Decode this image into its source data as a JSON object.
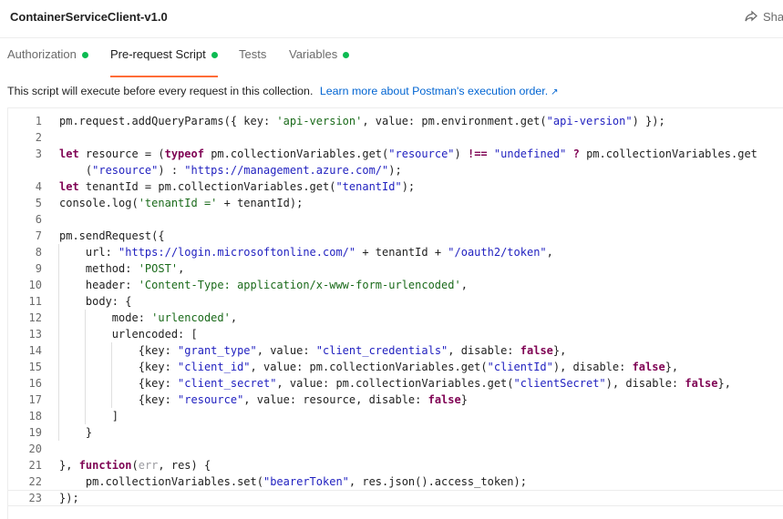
{
  "header": {
    "title": "ContainerServiceClient-v1.0",
    "share_label": "Sha"
  },
  "tabs": [
    {
      "label": "Authorization",
      "active": false,
      "dot": true
    },
    {
      "label": "Pre-request Script",
      "active": true,
      "dot": true
    },
    {
      "label": "Tests",
      "active": false,
      "dot": false
    },
    {
      "label": "Variables",
      "active": false,
      "dot": true
    }
  ],
  "description": {
    "text": "This script will execute before every request in this collection.",
    "link": "Learn more about Postman's execution order.",
    "link_icon": "↗"
  },
  "editor": {
    "lines": [
      {
        "num": "1",
        "tokens": [
          [
            "",
            "pm.request.addQueryParams({ key: "
          ],
          [
            "str2",
            "'api-version'"
          ],
          [
            "",
            ", value: pm.environment.get("
          ],
          [
            "str",
            "\"api-version\""
          ],
          [
            "",
            ") });"
          ]
        ]
      },
      {
        "num": "2",
        "tokens": []
      },
      {
        "num": "3",
        "tokens": [
          [
            "kw",
            "let"
          ],
          [
            "",
            " resource = ("
          ],
          [
            "kw",
            "typeof"
          ],
          [
            "",
            " pm.collectionVariables.get("
          ],
          [
            "str",
            "\"resource\""
          ],
          [
            "",
            ") "
          ],
          [
            "kw",
            "!=="
          ],
          [
            "",
            " "
          ],
          [
            "str",
            "\"undefined\""
          ],
          [
            "",
            " "
          ],
          [
            "kw",
            "?"
          ],
          [
            "",
            " pm.collectionVariables.get"
          ]
        ]
      },
      {
        "num": "",
        "tokens": [
          [
            "",
            "    ("
          ],
          [
            "str",
            "\"resource\""
          ],
          [
            "",
            ") : "
          ],
          [
            "str",
            "\"https://management.azure.com/\""
          ],
          [
            "",
            ");"
          ]
        ]
      },
      {
        "num": "4",
        "tokens": [
          [
            "kw",
            "let"
          ],
          [
            "",
            " tenantId = pm.collectionVariables.get("
          ],
          [
            "str",
            "\"tenantId\""
          ],
          [
            "",
            ");"
          ]
        ]
      },
      {
        "num": "5",
        "tokens": [
          [
            "",
            "console.log("
          ],
          [
            "str2",
            "'tenantId ='"
          ],
          [
            "",
            " + tenantId);"
          ]
        ]
      },
      {
        "num": "6",
        "tokens": []
      },
      {
        "num": "7",
        "tokens": [
          [
            "",
            "pm.sendRequest({"
          ]
        ]
      },
      {
        "num": "8",
        "tokens": [
          [
            "",
            "    url: "
          ],
          [
            "str",
            "\"https://login.microsoftonline.com/\""
          ],
          [
            "",
            " + tenantId + "
          ],
          [
            "str",
            "\"/oauth2/token\""
          ],
          [
            "",
            ","
          ]
        ]
      },
      {
        "num": "9",
        "tokens": [
          [
            "",
            "    method: "
          ],
          [
            "str2",
            "'POST'"
          ],
          [
            "",
            ","
          ]
        ]
      },
      {
        "num": "10",
        "tokens": [
          [
            "",
            "    header: "
          ],
          [
            "str2",
            "'Content-Type: application/x-www-form-urlencoded'"
          ],
          [
            "",
            ","
          ]
        ]
      },
      {
        "num": "11",
        "tokens": [
          [
            "",
            "    body: {"
          ]
        ]
      },
      {
        "num": "12",
        "tokens": [
          [
            "",
            "        mode: "
          ],
          [
            "str2",
            "'urlencoded'"
          ],
          [
            "",
            ","
          ]
        ]
      },
      {
        "num": "13",
        "tokens": [
          [
            "",
            "        urlencoded: ["
          ]
        ]
      },
      {
        "num": "14",
        "tokens": [
          [
            "",
            "            {key: "
          ],
          [
            "str",
            "\"grant_type\""
          ],
          [
            "",
            ", value: "
          ],
          [
            "str",
            "\"client_credentials\""
          ],
          [
            "",
            ", disable: "
          ],
          [
            "kw",
            "false"
          ],
          [
            "",
            "},"
          ]
        ]
      },
      {
        "num": "15",
        "tokens": [
          [
            "",
            "            {key: "
          ],
          [
            "str",
            "\"client_id\""
          ],
          [
            "",
            ", value: pm.collectionVariables.get("
          ],
          [
            "str",
            "\"clientId\""
          ],
          [
            "",
            "), disable: "
          ],
          [
            "kw",
            "false"
          ],
          [
            "",
            "},"
          ]
        ]
      },
      {
        "num": "16",
        "tokens": [
          [
            "",
            "            {key: "
          ],
          [
            "str",
            "\"client_secret\""
          ],
          [
            "",
            ", value: pm.collectionVariables.get("
          ],
          [
            "str",
            "\"clientSecret\""
          ],
          [
            "",
            "), disable: "
          ],
          [
            "kw",
            "false"
          ],
          [
            "",
            "},"
          ]
        ]
      },
      {
        "num": "17",
        "tokens": [
          [
            "",
            "            {key: "
          ],
          [
            "str",
            "\"resource\""
          ],
          [
            "",
            ", value: resource, disable: "
          ],
          [
            "kw",
            "false"
          ],
          [
            "",
            "}"
          ]
        ]
      },
      {
        "num": "18",
        "tokens": [
          [
            "",
            "        ]"
          ]
        ]
      },
      {
        "num": "19",
        "tokens": [
          [
            "",
            "    }"
          ]
        ]
      },
      {
        "num": "20",
        "tokens": []
      },
      {
        "num": "21",
        "tokens": [
          [
            "",
            "}, "
          ],
          [
            "kw",
            "function"
          ],
          [
            "",
            "("
          ],
          [
            "param",
            "err"
          ],
          [
            "",
            ", res) {"
          ]
        ]
      },
      {
        "num": "22",
        "tokens": [
          [
            "",
            "    pm.collectionVariables.set("
          ],
          [
            "str",
            "\"bearerToken\""
          ],
          [
            "",
            ", res.json().access_token);"
          ]
        ]
      },
      {
        "num": "23",
        "tokens": [
          [
            "",
            "});"
          ]
        ]
      }
    ]
  }
}
